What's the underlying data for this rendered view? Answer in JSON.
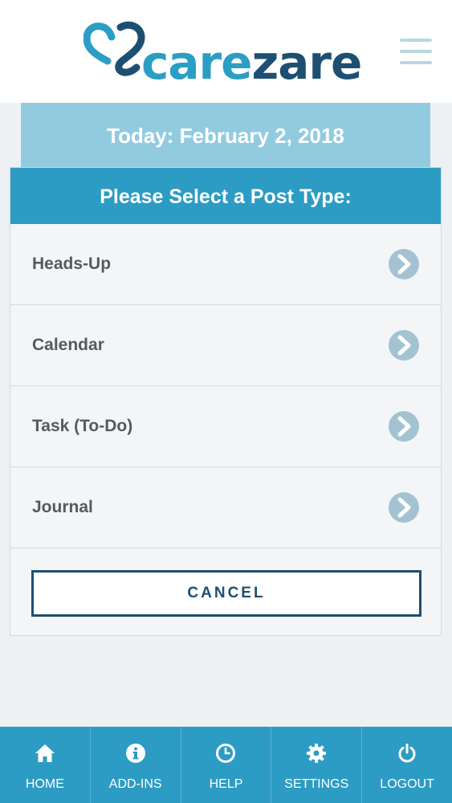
{
  "header": {
    "logo": {
      "part1": "care",
      "part2": "zare"
    },
    "menu_icon": "hamburger-menu-icon"
  },
  "date_bar": {
    "text": "Today: February 2, 2018"
  },
  "post_type_panel": {
    "title": "Please Select a Post Type:",
    "options": [
      {
        "label": "Heads-Up",
        "icon": "chevron-right-circle-icon"
      },
      {
        "label": "Calendar",
        "icon": "chevron-right-circle-icon"
      },
      {
        "label": "Task (To-Do)",
        "icon": "chevron-right-circle-icon"
      },
      {
        "label": "Journal",
        "icon": "chevron-right-circle-icon"
      }
    ],
    "cancel_label": "CANCEL"
  },
  "bottom_nav": {
    "items": [
      {
        "label": "HOME",
        "icon": "home-icon"
      },
      {
        "label": "ADD-INS",
        "icon": "info-icon"
      },
      {
        "label": "HELP",
        "icon": "clock-icon"
      },
      {
        "label": "SETTINGS",
        "icon": "gear-icon"
      },
      {
        "label": "LOGOUT",
        "icon": "power-icon"
      }
    ]
  },
  "colors": {
    "brand_light": "#2b9ec4",
    "brand_dark": "#1d4f72",
    "date_bar": "#92cbe0",
    "panel_header": "#2d9cc4",
    "chevron": "#a3c3d3",
    "background": "#eef1f4"
  }
}
